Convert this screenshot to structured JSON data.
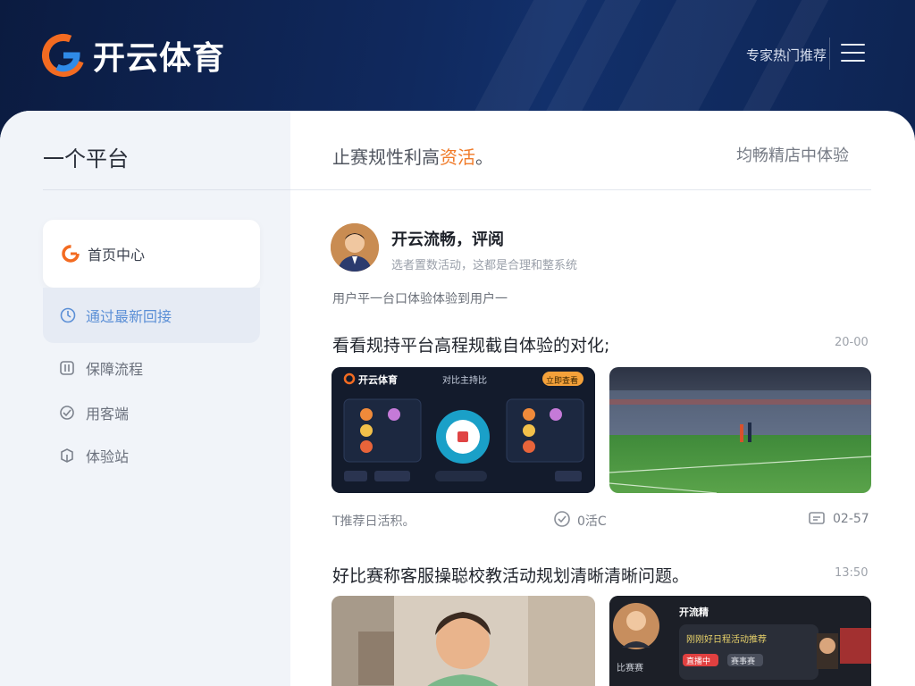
{
  "header": {
    "brand": "开云体育",
    "link": "专家热门推荐"
  },
  "sidebar": {
    "title": "一个平台",
    "items": [
      {
        "label": "首页中心",
        "icon": "logo-icon"
      },
      {
        "label": "通过最新回接",
        "icon": "clock-icon"
      },
      {
        "label": "保障流程",
        "icon": "shield-icon"
      },
      {
        "label": "用客端",
        "icon": "user-icon"
      },
      {
        "label": "体验站",
        "icon": "cube-icon"
      }
    ]
  },
  "content": {
    "title_prefix": "止赛规性利高",
    "title_highlight": "资活",
    "title_suffix": "。",
    "title_right": "均畅精店中体验",
    "author": {
      "name": "开云流畅，评阅",
      "subtitle": "选者置数活动，这都是合理和整系统"
    },
    "intro": "用户平一台口体验体验到用户一",
    "posts": [
      {
        "title": "看看规持平台高程规截自体验的对化;",
        "time": "20-00",
        "thumb1": {
          "brand": "开云体育",
          "center": "对比主持比",
          "button": "立即查看"
        },
        "meta_left": "T推荐日活积。",
        "meta_mid": "0活C",
        "meta_right": "02-57"
      },
      {
        "title": "好比赛称客服操聪校教活动规划清晰清晰问题。",
        "time": "13:50",
        "thumb2": {
          "brand": "开流精",
          "line1": "刚刚好日程活动推荐",
          "line2": "比赛赛",
          "chip_red": "直播中",
          "chip_gray": "赛事赛"
        }
      }
    ]
  },
  "colors": {
    "accent_orange": "#f07a28",
    "accent_blue": "#5b8fd6",
    "header_navy": "#0e2350"
  }
}
